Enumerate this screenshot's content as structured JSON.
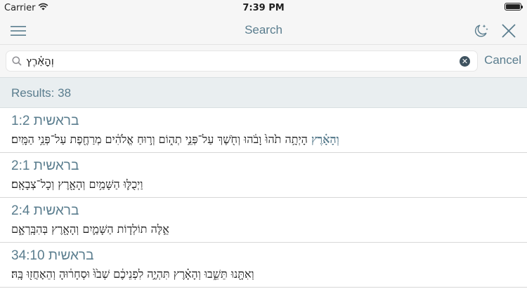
{
  "status_bar": {
    "carrier": "Carrier",
    "time": "7:39 PM"
  },
  "navbar": {
    "title": "Search",
    "menu_icon": "hamburger-icon",
    "night_icon": "moon-stars-icon",
    "close_icon": "close-icon"
  },
  "search": {
    "value": "וְהָאָ֗רֶץ",
    "cancel_label": "Cancel"
  },
  "results": {
    "label": "Results: 38",
    "items": [
      {
        "book": "בראשית",
        "ref": "1:2",
        "match": "וְהָאָ֗רֶץ",
        "rest": " הָיְתָ֥ה תֹ֙הוּ֙ וָבֹ֔הוּ וְחֹ֖שֶׁךְ עַל־פְּנֵ֣י תְה֑וֹם וְר֣וּחַ אֱלֹהִ֔ים מְרַחֶ֖פֶת עַל־פְּנֵ֥י הַמָּֽיִם׃"
      },
      {
        "book": "בראשית",
        "ref": "2:1",
        "match": "",
        "rest": "וַיְכֻלּ֛וּ הַשָּׁמַ֥יִם וְהָאָ֖רֶץ וְכָל־צְבָאָֽם׃"
      },
      {
        "book": "בראשית",
        "ref": "2:4",
        "match": "",
        "rest": "אֵ֣לֶּה תוֹלְד֧וֹת הַשָּׁמַ֛יִם וְהָאָ֖רֶץ בְּהִבָּֽרְאָ֑ם"
      },
      {
        "book": "בראשית",
        "ref": "34:10",
        "match": "",
        "rest": "וְאִתָּ֖נוּ תֵּשֵׁ֑בוּ וְהָאָ֗רֶץ תִּהְיֶ֣ה לִפְנֵיכֶ֔ם שְׁב֙וּ֙ וּסְחָר֔וּהָ וְהֵאָחֲז֖וּ בָּֽהּ׃"
      }
    ]
  },
  "colors": {
    "accent": "#5a7d8e",
    "header_bg": "#f6f6f6",
    "results_bg": "#e9eef0"
  }
}
